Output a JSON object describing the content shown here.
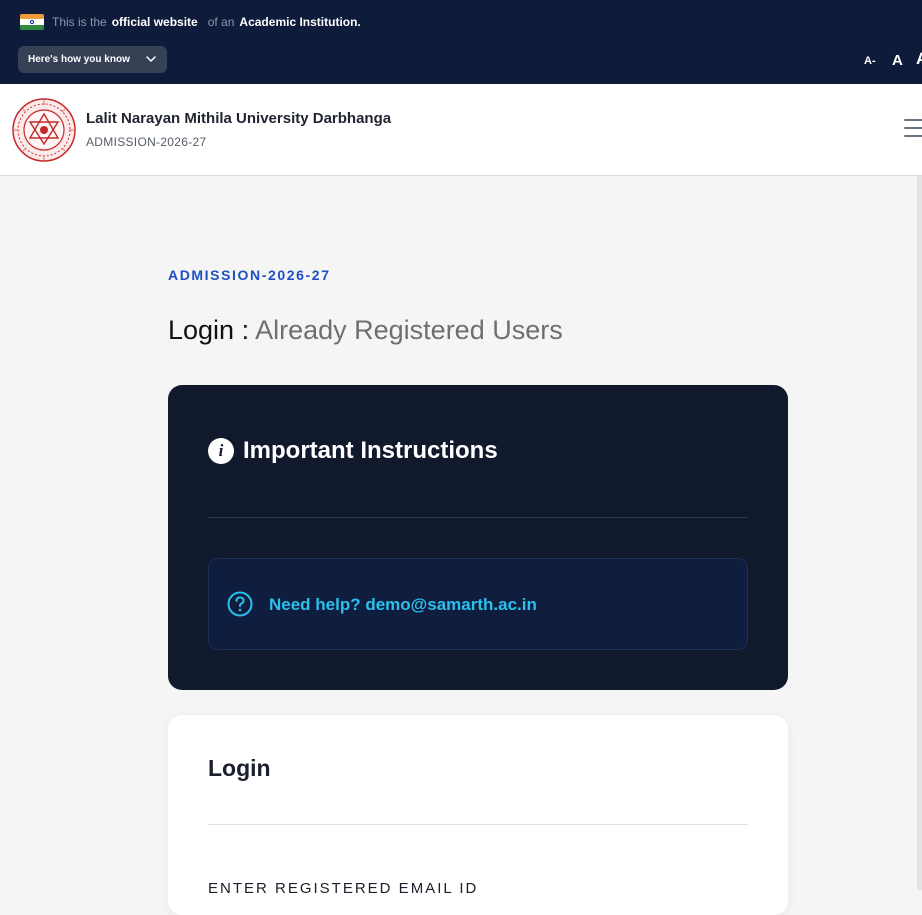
{
  "banner": {
    "prefix": "This is the",
    "official": "official website",
    "of_an": "of an",
    "institution": "Academic Institution.",
    "know_button": "Here's how you know",
    "font_small": "A-",
    "font_normal": "A",
    "font_large": "A"
  },
  "header": {
    "university_name": "Lalit Narayan Mithila University Darbhanga",
    "subtitle": "ADMISSION-2026-27"
  },
  "main": {
    "kicker": "ADMISSION-2026-27",
    "title_main": "Login :",
    "title_sub": "Already Registered Users",
    "instructions": {
      "title": "Important Instructions",
      "help_text": "Need help? demo@samarth.ac.in"
    },
    "login": {
      "title": "Login",
      "email_label": "ENTER REGISTERED EMAIL ID"
    }
  },
  "colors": {
    "banner_bg": "#0f1b3a",
    "accent_blue": "#1e4fc4",
    "card_dark": "#111a2d",
    "help_cyan": "#2bc0ec"
  }
}
